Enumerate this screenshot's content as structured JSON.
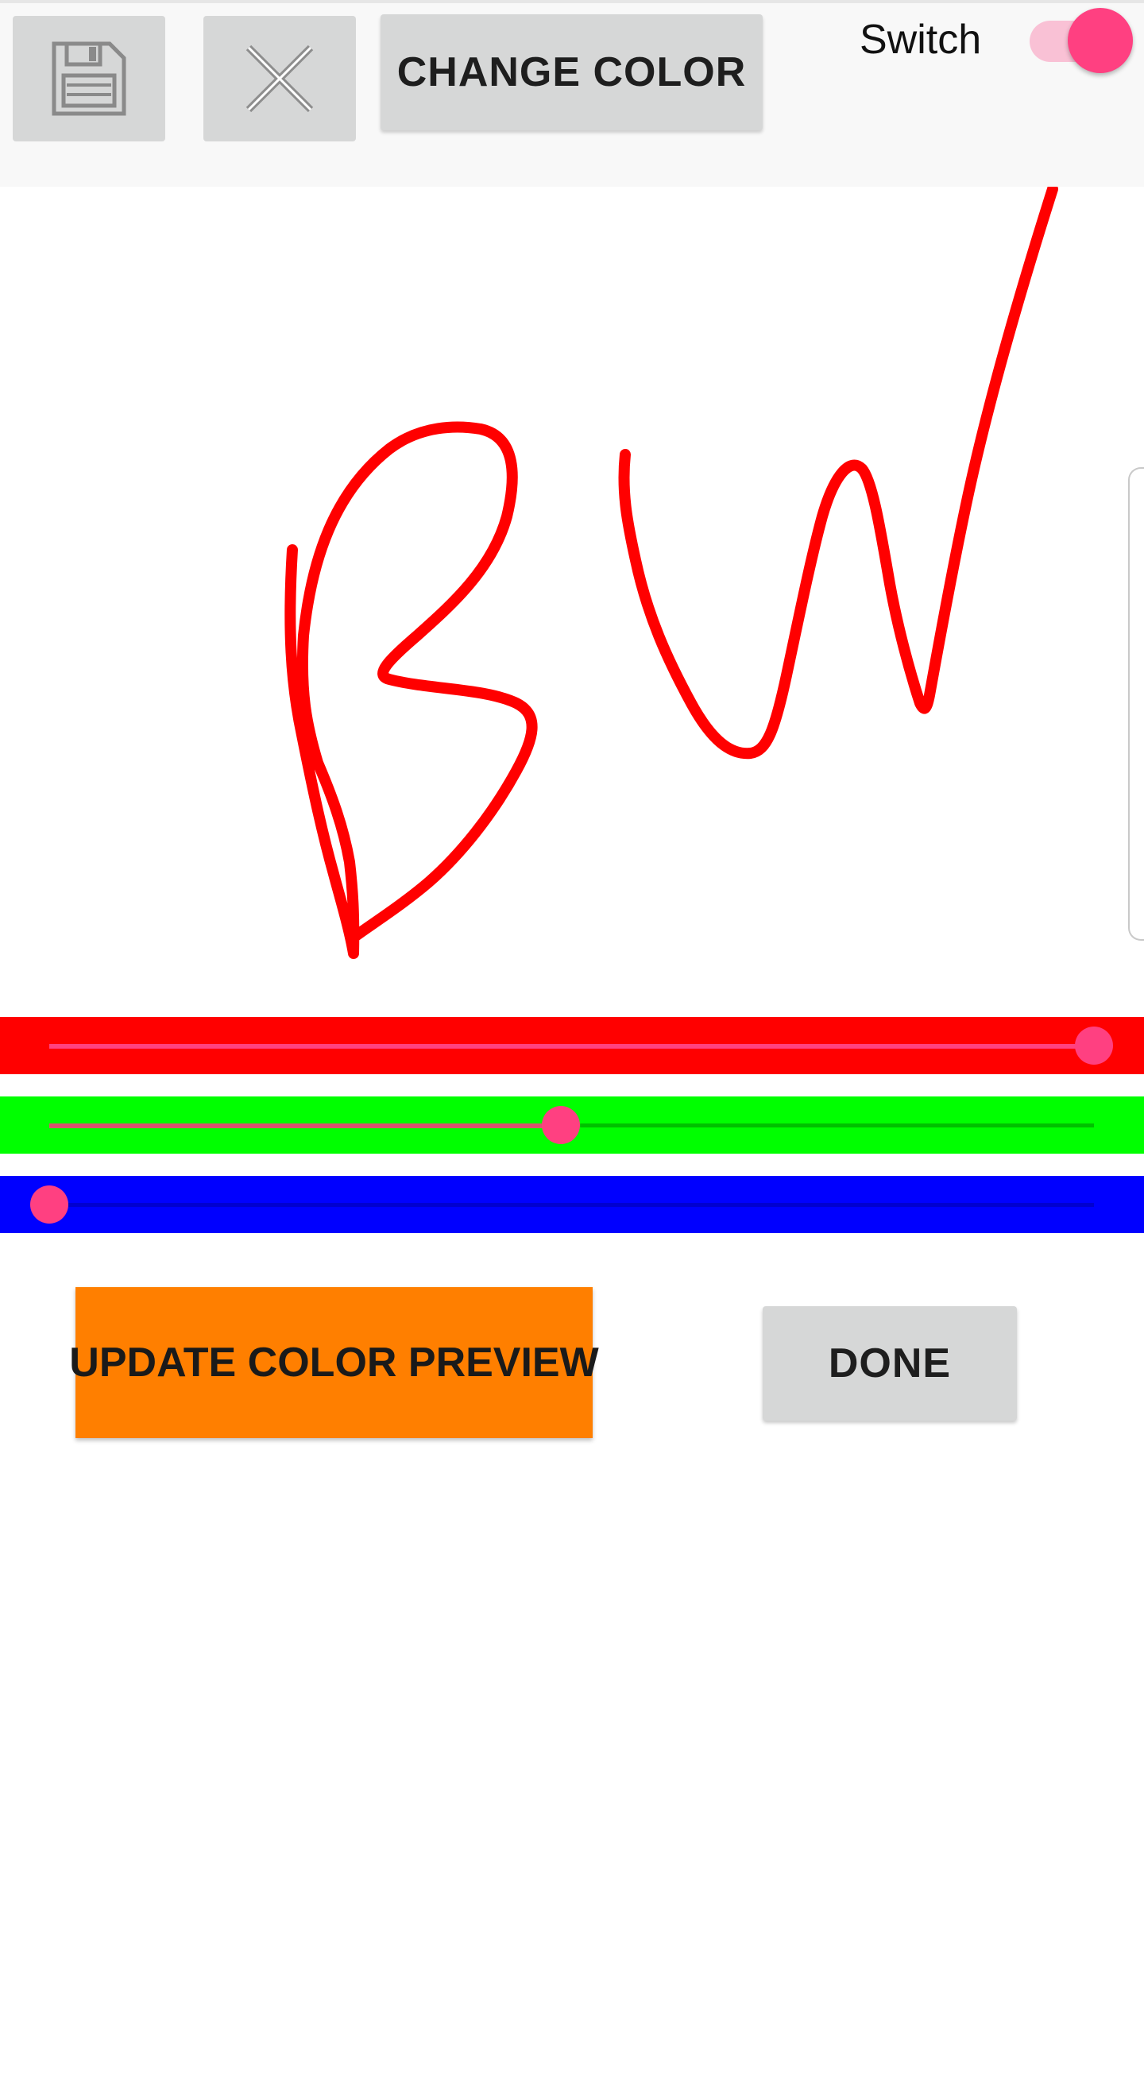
{
  "toolbar": {
    "save_icon": "floppy-disk-save-icon",
    "clear_icon": "close-x-icon",
    "change_color_label": "CHANGE COLOR",
    "switch_label": "Switch",
    "switch_on": true
  },
  "canvas": {
    "stroke_color": "#ff0000",
    "description_hidden": true
  },
  "sliders": [
    {
      "name": "red",
      "bar_color": "#ff0000",
      "value": 1.0
    },
    {
      "name": "green",
      "bar_color": "#00ff00",
      "value": 0.49
    },
    {
      "name": "blue",
      "bar_color": "#0000ff",
      "value": 0.0
    }
  ],
  "actions": {
    "update_preview_label": "UPDATE COLOR PREVIEW",
    "preview_color": "#ff7f00",
    "done_label": "DONE"
  },
  "colors": {
    "accent": "#ff4081",
    "button_gray": "#d6d7d7"
  }
}
